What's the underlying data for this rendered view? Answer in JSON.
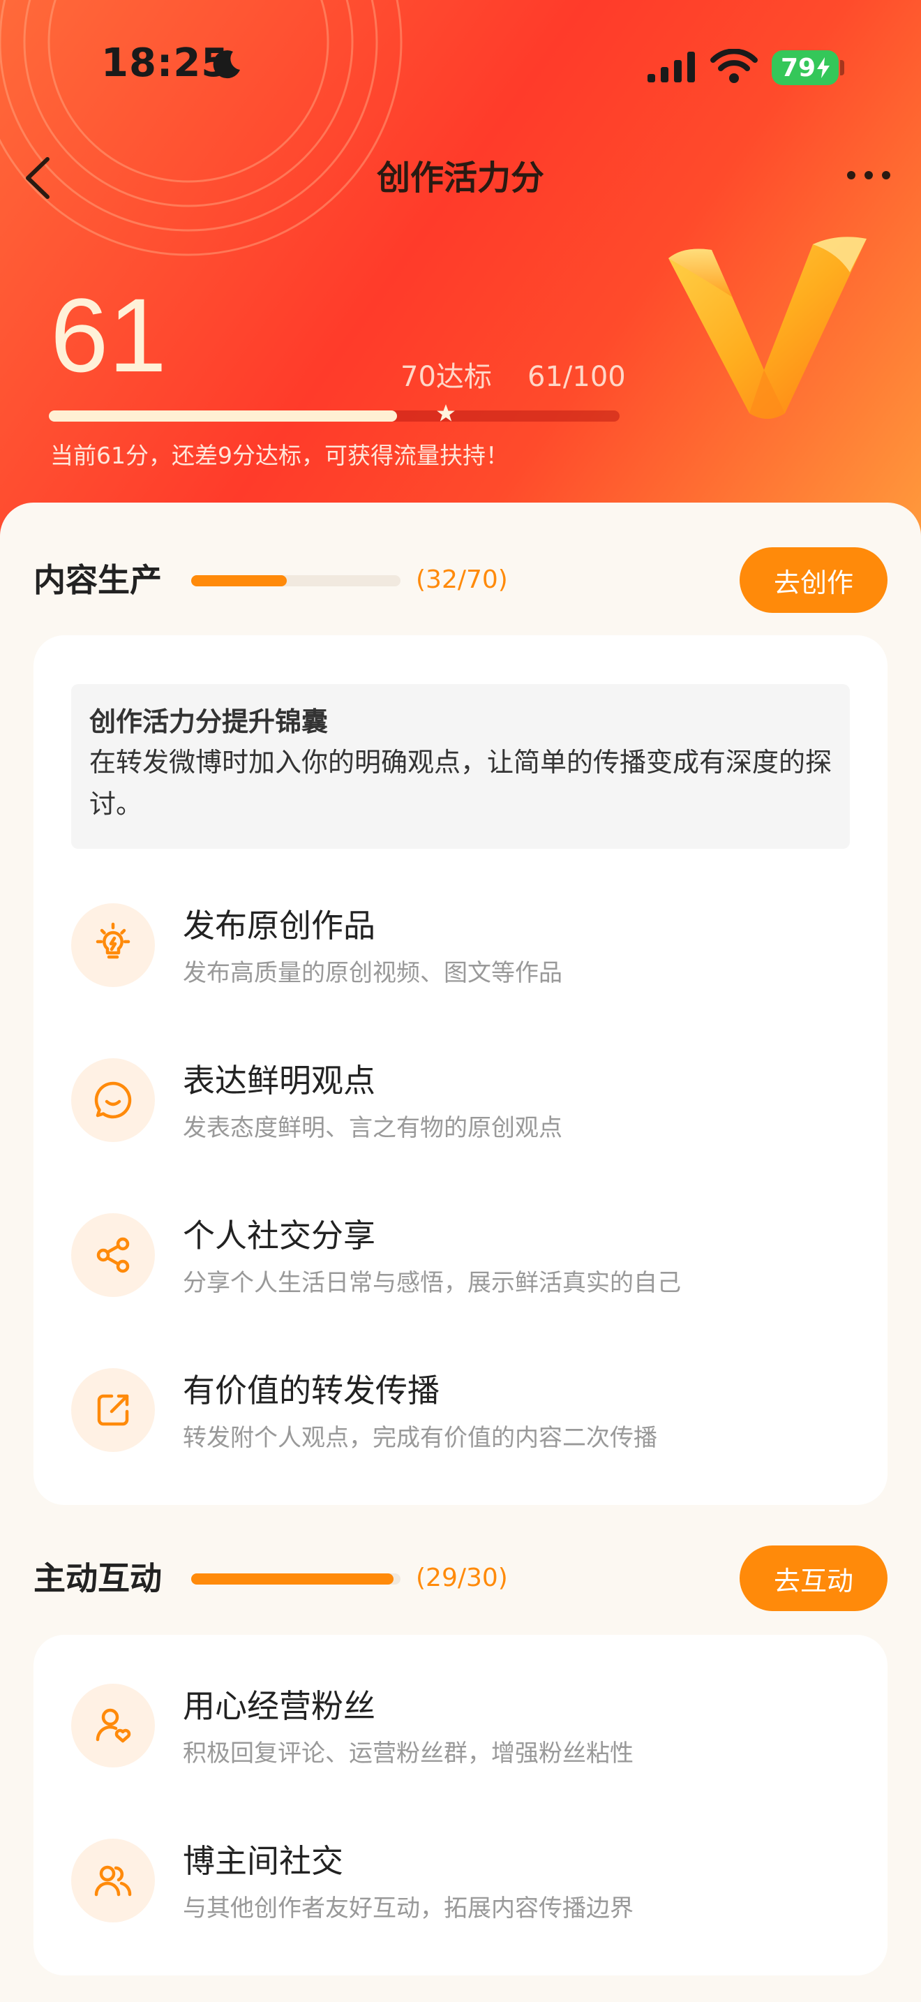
{
  "status_bar": {
    "time": "18:25",
    "battery": "79"
  },
  "nav": {
    "title": "创作活力分"
  },
  "score": {
    "value": "61",
    "goal_label": "70达标",
    "ratio_label": "61/100",
    "progress": 0.61,
    "goal_position": 0.7,
    "hint": "当前61分，还差9分达标，可获得流量扶持！"
  },
  "sections": [
    {
      "title": "内容生产",
      "count": "(32/70)",
      "progress": 0.457,
      "button": "去创作",
      "tip": {
        "title": "创作活力分提升锦囊",
        "text": "在转发微博时加入你的明确观点，让简单的传播变成有深度的探讨。"
      },
      "items": [
        {
          "icon": "lightbulb-icon",
          "title": "发布原创作品",
          "desc": "发布高质量的原创视频、图文等作品"
        },
        {
          "icon": "smile-chat-icon",
          "title": "表达鲜明观点",
          "desc": "发表态度鲜明、言之有物的原创观点"
        },
        {
          "icon": "share-icon",
          "title": "个人社交分享",
          "desc": "分享个人生活日常与感悟，展示鲜活真实的自己"
        },
        {
          "icon": "forward-icon",
          "title": "有价值的转发传播",
          "desc": "转发附个人观点，完成有价值的内容二次传播"
        }
      ]
    },
    {
      "title": "主动互动",
      "count": "(29/30)",
      "progress": 0.967,
      "button": "去互动",
      "items": [
        {
          "icon": "user-heart-icon",
          "title": "用心经营粉丝",
          "desc": "积极回复评论、运营粉丝群，增强粉丝粘性"
        },
        {
          "icon": "users-icon",
          "title": "博主间社交",
          "desc": "与其他创作者友好互动，拓展内容传播边界"
        }
      ]
    }
  ],
  "colors": {
    "accent": "#FF8A0A",
    "hero_red": "#FF3B2A",
    "icon_bg": "#FFF1E4"
  }
}
